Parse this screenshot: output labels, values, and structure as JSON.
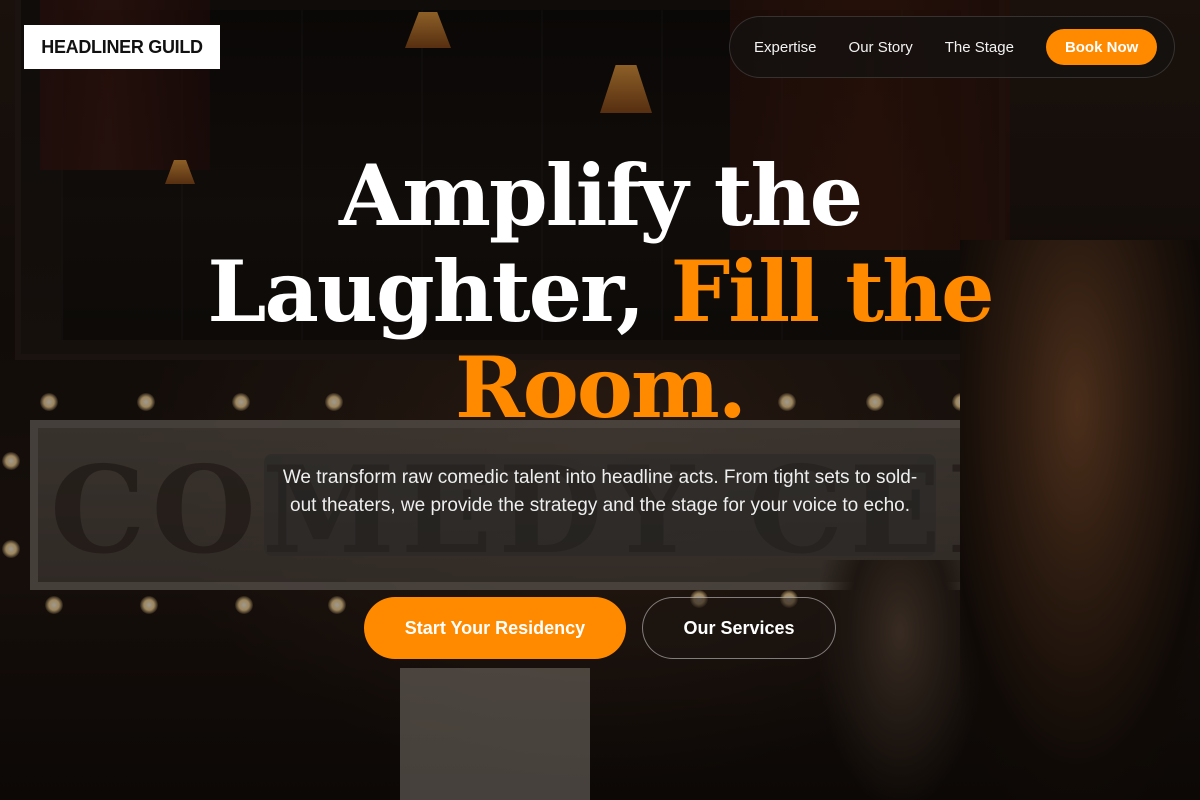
{
  "brand": {
    "name": "HEADLINER GUILD"
  },
  "nav": {
    "links": [
      "Expertise",
      "Our Story",
      "The Stage"
    ],
    "cta": "Book Now"
  },
  "hero": {
    "title_line1": "Amplify the",
    "title_line2_white": "Laughter, ",
    "title_line2_accent": "Fill the",
    "title_line3_accent": "Room.",
    "subtitle": "We transform raw comedic talent into headline acts. From tight sets to sold-out theaters, we provide the strategy and the stage for your voice to echo.",
    "primary_cta": "Start Your Residency",
    "secondary_cta": "Our Services"
  },
  "theme": {
    "accent": "#ff8a00",
    "text": "#ffffff"
  }
}
